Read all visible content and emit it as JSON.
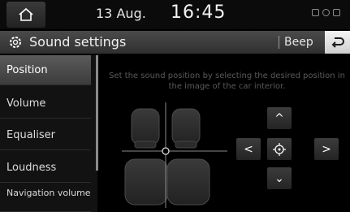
{
  "status": {
    "date": "13 Aug.",
    "time": "16:45"
  },
  "header": {
    "title": "Sound settings",
    "beep_label": "Beep"
  },
  "sidebar": {
    "items": [
      {
        "label": "Position",
        "active": true
      },
      {
        "label": "Volume",
        "active": false
      },
      {
        "label": "Equaliser",
        "active": false
      },
      {
        "label": "Loudness",
        "active": false
      },
      {
        "label": "Navigation volume",
        "active": false
      }
    ]
  },
  "main": {
    "instruction": "Set the sound position by selecting the desired position in the image of the car interior.",
    "controls": {
      "up": "^",
      "down": "⌄",
      "left": "<",
      "right": ">"
    }
  }
}
